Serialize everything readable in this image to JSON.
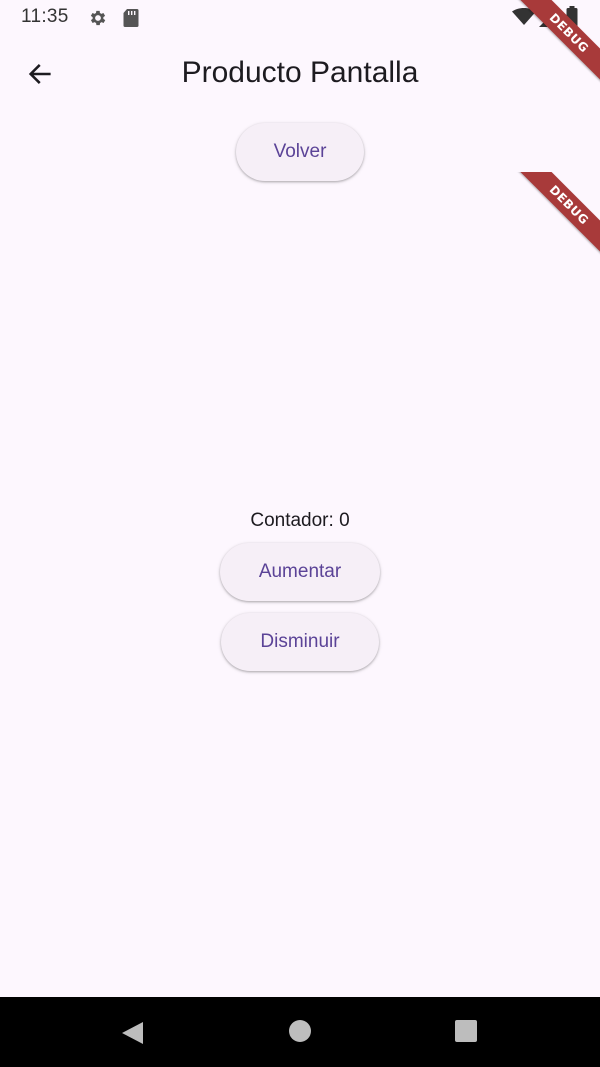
{
  "status_bar": {
    "time": "11:35",
    "icons": [
      "gear-icon",
      "sd-card-icon",
      "wifi-icon",
      "signal-icon",
      "battery-icon"
    ]
  },
  "app_bar": {
    "title": "Producto Pantalla",
    "back_icon": "arrow-back-icon"
  },
  "buttons": {
    "volver": "Volver",
    "aumentar": "Aumentar",
    "disminuir": "Disminuir"
  },
  "counter": {
    "text": "Contador: 0"
  },
  "debug_banners": [
    "DEBUG",
    "DEBUG"
  ],
  "nav_bar": {
    "icons": [
      "nav-back-icon",
      "nav-home-icon",
      "nav-recents-icon"
    ]
  },
  "colors": {
    "background": "#fdf7fe",
    "button_bg": "#f6eff7",
    "button_text": "#5b4397",
    "debug_ribbon": "#a83a3a"
  }
}
